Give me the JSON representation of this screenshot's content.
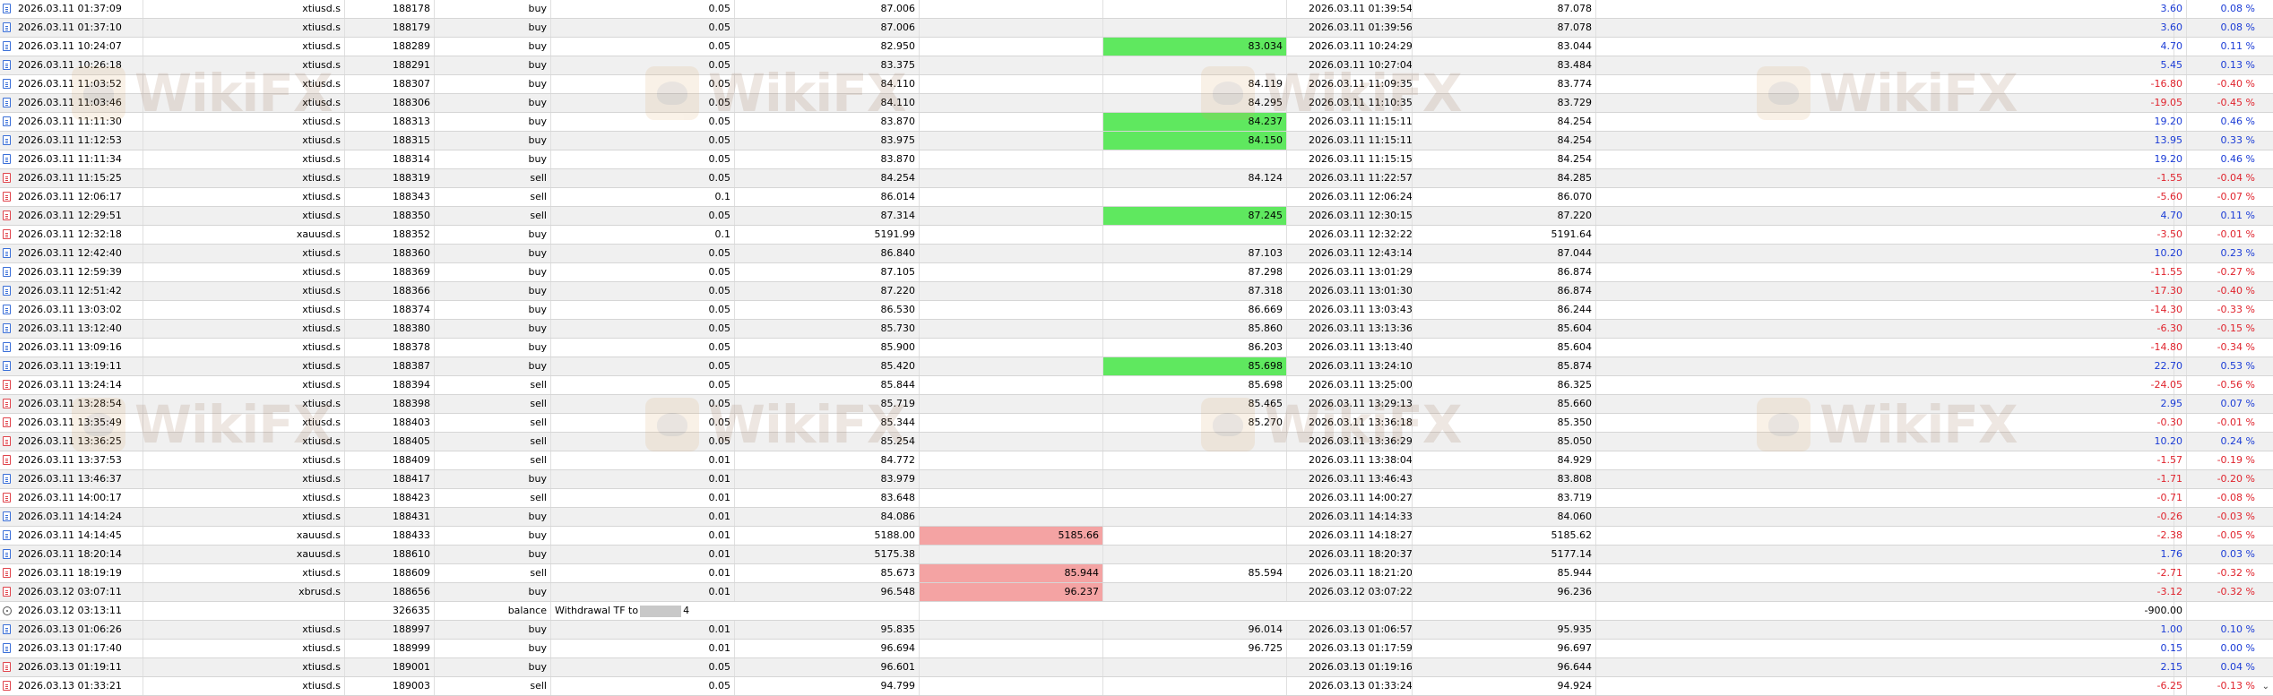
{
  "watermark_text": "WikiFX",
  "rows": [
    {
      "icon": "buy",
      "time": "2026.03.11 01:37:09",
      "symbol": "xtiusd.s",
      "ticket": "188178",
      "type": "buy",
      "volume": "0.05",
      "price": "87.006",
      "sl": "",
      "tp": "",
      "sl_hl": "",
      "tp_hl": "",
      "close_time": "2026.03.11 01:39:54",
      "close_price": "87.078",
      "profit": "3.60",
      "pct": "0.08 %",
      "sign": "pos"
    },
    {
      "icon": "buy",
      "time": "2026.03.11 01:37:10",
      "symbol": "xtiusd.s",
      "ticket": "188179",
      "type": "buy",
      "volume": "0.05",
      "price": "87.006",
      "sl": "",
      "tp": "",
      "sl_hl": "",
      "tp_hl": "",
      "close_time": "2026.03.11 01:39:56",
      "close_price": "87.078",
      "profit": "3.60",
      "pct": "0.08 %",
      "sign": "pos"
    },
    {
      "icon": "buy",
      "time": "2026.03.11 10:24:07",
      "symbol": "xtiusd.s",
      "ticket": "188289",
      "type": "buy",
      "volume": "0.05",
      "price": "82.950",
      "sl": "",
      "tp": "83.034",
      "sl_hl": "",
      "tp_hl": "green",
      "close_time": "2026.03.11 10:24:29",
      "close_price": "83.044",
      "profit": "4.70",
      "pct": "0.11 %",
      "sign": "pos"
    },
    {
      "icon": "buy",
      "time": "2026.03.11 10:26:18",
      "symbol": "xtiusd.s",
      "ticket": "188291",
      "type": "buy",
      "volume": "0.05",
      "price": "83.375",
      "sl": "",
      "tp": "",
      "sl_hl": "",
      "tp_hl": "",
      "close_time": "2026.03.11 10:27:04",
      "close_price": "83.484",
      "profit": "5.45",
      "pct": "0.13 %",
      "sign": "pos"
    },
    {
      "icon": "buy",
      "time": "2026.03.11 11:03:52",
      "symbol": "xtiusd.s",
      "ticket": "188307",
      "type": "buy",
      "volume": "0.05",
      "price": "84.110",
      "sl": "",
      "tp": "84.119",
      "sl_hl": "",
      "tp_hl": "",
      "close_time": "2026.03.11 11:09:35",
      "close_price": "83.774",
      "profit": "-16.80",
      "pct": "-0.40 %",
      "sign": "neg"
    },
    {
      "icon": "buy",
      "time": "2026.03.11 11:03:46",
      "symbol": "xtiusd.s",
      "ticket": "188306",
      "type": "buy",
      "volume": "0.05",
      "price": "84.110",
      "sl": "",
      "tp": "84.295",
      "sl_hl": "",
      "tp_hl": "",
      "close_time": "2026.03.11 11:10:35",
      "close_price": "83.729",
      "profit": "-19.05",
      "pct": "-0.45 %",
      "sign": "neg"
    },
    {
      "icon": "buy",
      "time": "2026.03.11 11:11:30",
      "symbol": "xtiusd.s",
      "ticket": "188313",
      "type": "buy",
      "volume": "0.05",
      "price": "83.870",
      "sl": "",
      "tp": "84.237",
      "sl_hl": "",
      "tp_hl": "green",
      "close_time": "2026.03.11 11:15:11",
      "close_price": "84.254",
      "profit": "19.20",
      "pct": "0.46 %",
      "sign": "pos"
    },
    {
      "icon": "buy",
      "time": "2026.03.11 11:12:53",
      "symbol": "xtiusd.s",
      "ticket": "188315",
      "type": "buy",
      "volume": "0.05",
      "price": "83.975",
      "sl": "",
      "tp": "84.150",
      "sl_hl": "",
      "tp_hl": "green",
      "close_time": "2026.03.11 11:15:11",
      "close_price": "84.254",
      "profit": "13.95",
      "pct": "0.33 %",
      "sign": "pos"
    },
    {
      "icon": "buy",
      "time": "2026.03.11 11:11:34",
      "symbol": "xtiusd.s",
      "ticket": "188314",
      "type": "buy",
      "volume": "0.05",
      "price": "83.870",
      "sl": "",
      "tp": "",
      "sl_hl": "",
      "tp_hl": "",
      "close_time": "2026.03.11 11:15:15",
      "close_price": "84.254",
      "profit": "19.20",
      "pct": "0.46 %",
      "sign": "pos"
    },
    {
      "icon": "sell",
      "time": "2026.03.11 11:15:25",
      "symbol": "xtiusd.s",
      "ticket": "188319",
      "type": "sell",
      "volume": "0.05",
      "price": "84.254",
      "sl": "",
      "tp": "84.124",
      "sl_hl": "",
      "tp_hl": "",
      "close_time": "2026.03.11 11:22:57",
      "close_price": "84.285",
      "profit": "-1.55",
      "pct": "-0.04 %",
      "sign": "neg"
    },
    {
      "icon": "sell",
      "time": "2026.03.11 12:06:17",
      "symbol": "xtiusd.s",
      "ticket": "188343",
      "type": "sell",
      "volume": "0.1",
      "price": "86.014",
      "sl": "",
      "tp": "",
      "sl_hl": "",
      "tp_hl": "",
      "close_time": "2026.03.11 12:06:24",
      "close_price": "86.070",
      "profit": "-5.60",
      "pct": "-0.07 %",
      "sign": "neg"
    },
    {
      "icon": "sell",
      "time": "2026.03.11 12:29:51",
      "symbol": "xtiusd.s",
      "ticket": "188350",
      "type": "sell",
      "volume": "0.05",
      "price": "87.314",
      "sl": "",
      "tp": "87.245",
      "sl_hl": "",
      "tp_hl": "green",
      "close_time": "2026.03.11 12:30:15",
      "close_price": "87.220",
      "profit": "4.70",
      "pct": "0.11 %",
      "sign": "pos"
    },
    {
      "icon": "sell",
      "time": "2026.03.11 12:32:18",
      "symbol": "xauusd.s",
      "ticket": "188352",
      "type": "buy",
      "volume": "0.1",
      "price": "5191.99",
      "sl": "",
      "tp": "",
      "sl_hl": "",
      "tp_hl": "",
      "close_time": "2026.03.11 12:32:22",
      "close_price": "5191.64",
      "profit": "-3.50",
      "pct": "-0.01 %",
      "sign": "neg"
    },
    {
      "icon": "buy",
      "time": "2026.03.11 12:42:40",
      "symbol": "xtiusd.s",
      "ticket": "188360",
      "type": "buy",
      "volume": "0.05",
      "price": "86.840",
      "sl": "",
      "tp": "87.103",
      "sl_hl": "",
      "tp_hl": "",
      "close_time": "2026.03.11 12:43:14",
      "close_price": "87.044",
      "profit": "10.20",
      "pct": "0.23 %",
      "sign": "pos"
    },
    {
      "icon": "buy",
      "time": "2026.03.11 12:59:39",
      "symbol": "xtiusd.s",
      "ticket": "188369",
      "type": "buy",
      "volume": "0.05",
      "price": "87.105",
      "sl": "",
      "tp": "87.298",
      "sl_hl": "",
      "tp_hl": "",
      "close_time": "2026.03.11 13:01:29",
      "close_price": "86.874",
      "profit": "-11.55",
      "pct": "-0.27 %",
      "sign": "neg"
    },
    {
      "icon": "buy",
      "time": "2026.03.11 12:51:42",
      "symbol": "xtiusd.s",
      "ticket": "188366",
      "type": "buy",
      "volume": "0.05",
      "price": "87.220",
      "sl": "",
      "tp": "87.318",
      "sl_hl": "",
      "tp_hl": "",
      "close_time": "2026.03.11 13:01:30",
      "close_price": "86.874",
      "profit": "-17.30",
      "pct": "-0.40 %",
      "sign": "neg"
    },
    {
      "icon": "buy",
      "time": "2026.03.11 13:03:02",
      "symbol": "xtiusd.s",
      "ticket": "188374",
      "type": "buy",
      "volume": "0.05",
      "price": "86.530",
      "sl": "",
      "tp": "86.669",
      "sl_hl": "",
      "tp_hl": "",
      "close_time": "2026.03.11 13:03:43",
      "close_price": "86.244",
      "profit": "-14.30",
      "pct": "-0.33 %",
      "sign": "neg"
    },
    {
      "icon": "buy",
      "time": "2026.03.11 13:12:40",
      "symbol": "xtiusd.s",
      "ticket": "188380",
      "type": "buy",
      "volume": "0.05",
      "price": "85.730",
      "sl": "",
      "tp": "85.860",
      "sl_hl": "",
      "tp_hl": "",
      "close_time": "2026.03.11 13:13:36",
      "close_price": "85.604",
      "profit": "-6.30",
      "pct": "-0.15 %",
      "sign": "neg"
    },
    {
      "icon": "buy",
      "time": "2026.03.11 13:09:16",
      "symbol": "xtiusd.s",
      "ticket": "188378",
      "type": "buy",
      "volume": "0.05",
      "price": "85.900",
      "sl": "",
      "tp": "86.203",
      "sl_hl": "",
      "tp_hl": "",
      "close_time": "2026.03.11 13:13:40",
      "close_price": "85.604",
      "profit": "-14.80",
      "pct": "-0.34 %",
      "sign": "neg"
    },
    {
      "icon": "buy",
      "time": "2026.03.11 13:19:11",
      "symbol": "xtiusd.s",
      "ticket": "188387",
      "type": "buy",
      "volume": "0.05",
      "price": "85.420",
      "sl": "",
      "tp": "85.698",
      "sl_hl": "",
      "tp_hl": "green",
      "close_time": "2026.03.11 13:24:10",
      "close_price": "85.874",
      "profit": "22.70",
      "pct": "0.53 %",
      "sign": "pos"
    },
    {
      "icon": "sell",
      "time": "2026.03.11 13:24:14",
      "symbol": "xtiusd.s",
      "ticket": "188394",
      "type": "sell",
      "volume": "0.05",
      "price": "85.844",
      "sl": "",
      "tp": "85.698",
      "sl_hl": "",
      "tp_hl": "",
      "close_time": "2026.03.11 13:25:00",
      "close_price": "86.325",
      "profit": "-24.05",
      "pct": "-0.56 %",
      "sign": "neg"
    },
    {
      "icon": "sell",
      "time": "2026.03.11 13:28:54",
      "symbol": "xtiusd.s",
      "ticket": "188398",
      "type": "sell",
      "volume": "0.05",
      "price": "85.719",
      "sl": "",
      "tp": "85.465",
      "sl_hl": "",
      "tp_hl": "",
      "close_time": "2026.03.11 13:29:13",
      "close_price": "85.660",
      "profit": "2.95",
      "pct": "0.07 %",
      "sign": "pos"
    },
    {
      "icon": "sell",
      "time": "2026.03.11 13:35:49",
      "symbol": "xtiusd.s",
      "ticket": "188403",
      "type": "sell",
      "volume": "0.05",
      "price": "85.344",
      "sl": "",
      "tp": "85.270",
      "sl_hl": "",
      "tp_hl": "",
      "close_time": "2026.03.11 13:36:18",
      "close_price": "85.350",
      "profit": "-0.30",
      "pct": "-0.01 %",
      "sign": "neg"
    },
    {
      "icon": "sell",
      "time": "2026.03.11 13:36:25",
      "symbol": "xtiusd.s",
      "ticket": "188405",
      "type": "sell",
      "volume": "0.05",
      "price": "85.254",
      "sl": "",
      "tp": "",
      "sl_hl": "",
      "tp_hl": "",
      "close_time": "2026.03.11 13:36:29",
      "close_price": "85.050",
      "profit": "10.20",
      "pct": "0.24 %",
      "sign": "pos"
    },
    {
      "icon": "sell",
      "time": "2026.03.11 13:37:53",
      "symbol": "xtiusd.s",
      "ticket": "188409",
      "type": "sell",
      "volume": "0.01",
      "price": "84.772",
      "sl": "",
      "tp": "",
      "sl_hl": "",
      "tp_hl": "",
      "close_time": "2026.03.11 13:38:04",
      "close_price": "84.929",
      "profit": "-1.57",
      "pct": "-0.19 %",
      "sign": "neg"
    },
    {
      "icon": "buy",
      "time": "2026.03.11 13:46:37",
      "symbol": "xtiusd.s",
      "ticket": "188417",
      "type": "buy",
      "volume": "0.01",
      "price": "83.979",
      "sl": "",
      "tp": "",
      "sl_hl": "",
      "tp_hl": "",
      "close_time": "2026.03.11 13:46:43",
      "close_price": "83.808",
      "profit": "-1.71",
      "pct": "-0.20 %",
      "sign": "neg"
    },
    {
      "icon": "sell",
      "time": "2026.03.11 14:00:17",
      "symbol": "xtiusd.s",
      "ticket": "188423",
      "type": "sell",
      "volume": "0.01",
      "price": "83.648",
      "sl": "",
      "tp": "",
      "sl_hl": "",
      "tp_hl": "",
      "close_time": "2026.03.11 14:00:27",
      "close_price": "83.719",
      "profit": "-0.71",
      "pct": "-0.08 %",
      "sign": "neg"
    },
    {
      "icon": "buy",
      "time": "2026.03.11 14:14:24",
      "symbol": "xtiusd.s",
      "ticket": "188431",
      "type": "buy",
      "volume": "0.01",
      "price": "84.086",
      "sl": "",
      "tp": "",
      "sl_hl": "",
      "tp_hl": "",
      "close_time": "2026.03.11 14:14:33",
      "close_price": "84.060",
      "profit": "-0.26",
      "pct": "-0.03 %",
      "sign": "neg"
    },
    {
      "icon": "buy",
      "time": "2026.03.11 14:14:45",
      "symbol": "xauusd.s",
      "ticket": "188433",
      "type": "buy",
      "volume": "0.01",
      "price": "5188.00",
      "sl": "5185.66",
      "tp": "",
      "sl_hl": "red",
      "tp_hl": "",
      "close_time": "2026.03.11 14:18:27",
      "close_price": "5185.62",
      "profit": "-2.38",
      "pct": "-0.05 %",
      "sign": "neg"
    },
    {
      "icon": "buy",
      "time": "2026.03.11 18:20:14",
      "symbol": "xauusd.s",
      "ticket": "188610",
      "type": "buy",
      "volume": "0.01",
      "price": "5175.38",
      "sl": "",
      "tp": "",
      "sl_hl": "",
      "tp_hl": "",
      "close_time": "2026.03.11 18:20:37",
      "close_price": "5177.14",
      "profit": "1.76",
      "pct": "0.03 %",
      "sign": "pos"
    },
    {
      "icon": "sell",
      "time": "2026.03.11 18:19:19",
      "symbol": "xtiusd.s",
      "ticket": "188609",
      "type": "sell",
      "volume": "0.01",
      "price": "85.673",
      "sl": "85.944",
      "tp": "85.594",
      "sl_hl": "red",
      "tp_hl": "",
      "close_time": "2026.03.11 18:21:20",
      "close_price": "85.944",
      "profit": "-2.71",
      "pct": "-0.32 %",
      "sign": "neg"
    },
    {
      "icon": "sell",
      "time": "2026.03.12 03:07:11",
      "symbol": "xbrusd.s",
      "ticket": "188656",
      "type": "buy",
      "volume": "0.01",
      "price": "96.548",
      "sl": "96.237",
      "tp": "",
      "sl_hl": "red",
      "tp_hl": "",
      "close_time": "2026.03.12 03:07:22",
      "close_price": "96.236",
      "profit": "-3.12",
      "pct": "-0.32 %",
      "sign": "neg"
    },
    {
      "icon": "balance",
      "time": "2026.03.12 03:13:11",
      "symbol": "",
      "ticket": "326635",
      "type": "balance",
      "volume": "",
      "price": "",
      "sl": "",
      "tp": "",
      "sl_hl": "",
      "tp_hl": "",
      "comment_pre": "Withdrawal TF to",
      "comment_post": "4",
      "close_time": "",
      "close_price": "",
      "profit": "-900.00",
      "pct": "",
      "sign": "plain"
    },
    {
      "icon": "buy",
      "time": "2026.03.13 01:06:26",
      "symbol": "xtiusd.s",
      "ticket": "188997",
      "type": "buy",
      "volume": "0.01",
      "price": "95.835",
      "sl": "",
      "tp": "96.014",
      "sl_hl": "",
      "tp_hl": "",
      "close_time": "2026.03.13 01:06:57",
      "close_price": "95.935",
      "profit": "1.00",
      "pct": "0.10 %",
      "sign": "pos"
    },
    {
      "icon": "buy",
      "time": "2026.03.13 01:17:40",
      "symbol": "xtiusd.s",
      "ticket": "188999",
      "type": "buy",
      "volume": "0.01",
      "price": "96.694",
      "sl": "",
      "tp": "96.725",
      "sl_hl": "",
      "tp_hl": "",
      "close_time": "2026.03.13 01:17:59",
      "close_price": "96.697",
      "profit": "0.15",
      "pct": "0.00 %",
      "sign": "pos"
    },
    {
      "icon": "sell",
      "time": "2026.03.13 01:19:11",
      "symbol": "xtiusd.s",
      "ticket": "189001",
      "type": "buy",
      "volume": "0.05",
      "price": "96.601",
      "sl": "",
      "tp": "",
      "sl_hl": "",
      "tp_hl": "",
      "close_time": "2026.03.13 01:19:16",
      "close_price": "96.644",
      "profit": "2.15",
      "pct": "0.04 %",
      "sign": "pos"
    },
    {
      "icon": "sell",
      "time": "2026.03.13 01:33:21",
      "symbol": "xtiusd.s",
      "ticket": "189003",
      "type": "sell",
      "volume": "0.05",
      "price": "94.799",
      "sl": "",
      "tp": "",
      "sl_hl": "",
      "tp_hl": "",
      "close_time": "2026.03.13 01:33:24",
      "close_price": "94.924",
      "profit": "-6.25",
      "pct": "-0.13 %",
      "sign": "neg"
    }
  ]
}
